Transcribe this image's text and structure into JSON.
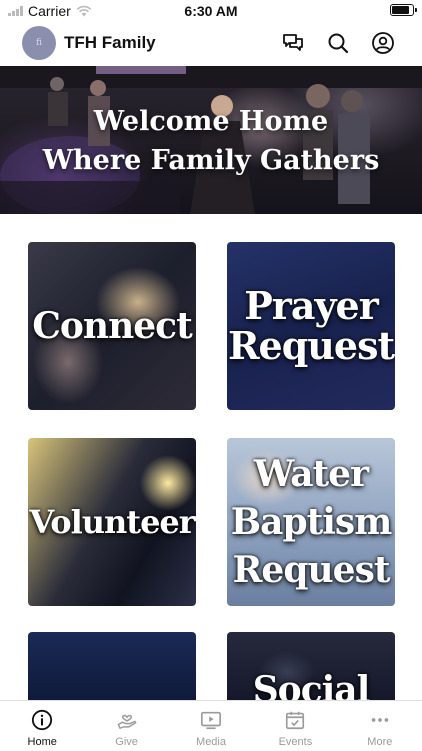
{
  "status_bar": {
    "carrier": "Carrier",
    "time": "6:30 AM",
    "icons": [
      "signal-icon",
      "wifi-icon",
      "battery-icon"
    ]
  },
  "header": {
    "title": "TFH Family",
    "logo_text": "fi",
    "icons": [
      "chat-icon",
      "search-icon",
      "profile-icon"
    ]
  },
  "hero": {
    "line1": "Welcome Home",
    "line2": "Where Family Gathers"
  },
  "tiles": [
    {
      "label_lines": [
        "Connect"
      ]
    },
    {
      "label_lines": [
        "Prayer",
        "Request"
      ]
    },
    {
      "label_lines": [
        "Volunteer"
      ]
    },
    {
      "label_lines": [
        "Water",
        "Baptism",
        "Request"
      ]
    },
    {
      "label_lines": [
        ""
      ]
    },
    {
      "label_lines": [
        "Social"
      ]
    }
  ],
  "tab_bar": {
    "active": "Home",
    "items": [
      {
        "label": "Home",
        "icon": "info-circle-icon"
      },
      {
        "label": "Give",
        "icon": "hand-heart-icon"
      },
      {
        "label": "Media",
        "icon": "play-screen-icon"
      },
      {
        "label": "Events",
        "icon": "calendar-check-icon"
      },
      {
        "label": "More",
        "icon": "more-dots-icon"
      }
    ]
  },
  "colors": {
    "active_tab": "#111111",
    "inactive_tab": "#9b9b9b",
    "logo_bg": "#8a8fae"
  }
}
